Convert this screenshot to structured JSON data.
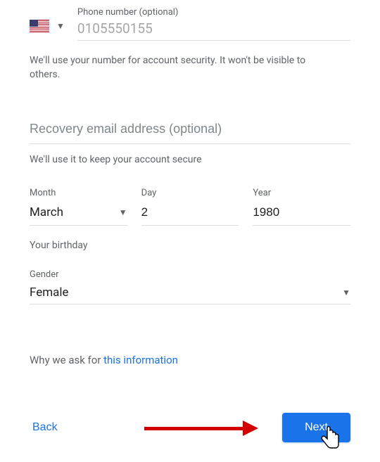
{
  "phone": {
    "label": "Phone number (optional)",
    "obscured_display": "0105550155",
    "helper": "We'll use your number for account security. It won't be visible to others."
  },
  "recovery": {
    "placeholder": "Recovery email address (optional)",
    "helper": "We'll use it to keep your account secure"
  },
  "dob": {
    "month_label": "Month",
    "month_value": "March",
    "day_label": "Day",
    "day_value": "2",
    "year_label": "Year",
    "year_value": "1980",
    "caption": "Your birthday"
  },
  "gender": {
    "label": "Gender",
    "value": "Female"
  },
  "why": {
    "prefix": "Why we ask for ",
    "link": "this information"
  },
  "buttons": {
    "back": "Back",
    "next": "Next"
  }
}
